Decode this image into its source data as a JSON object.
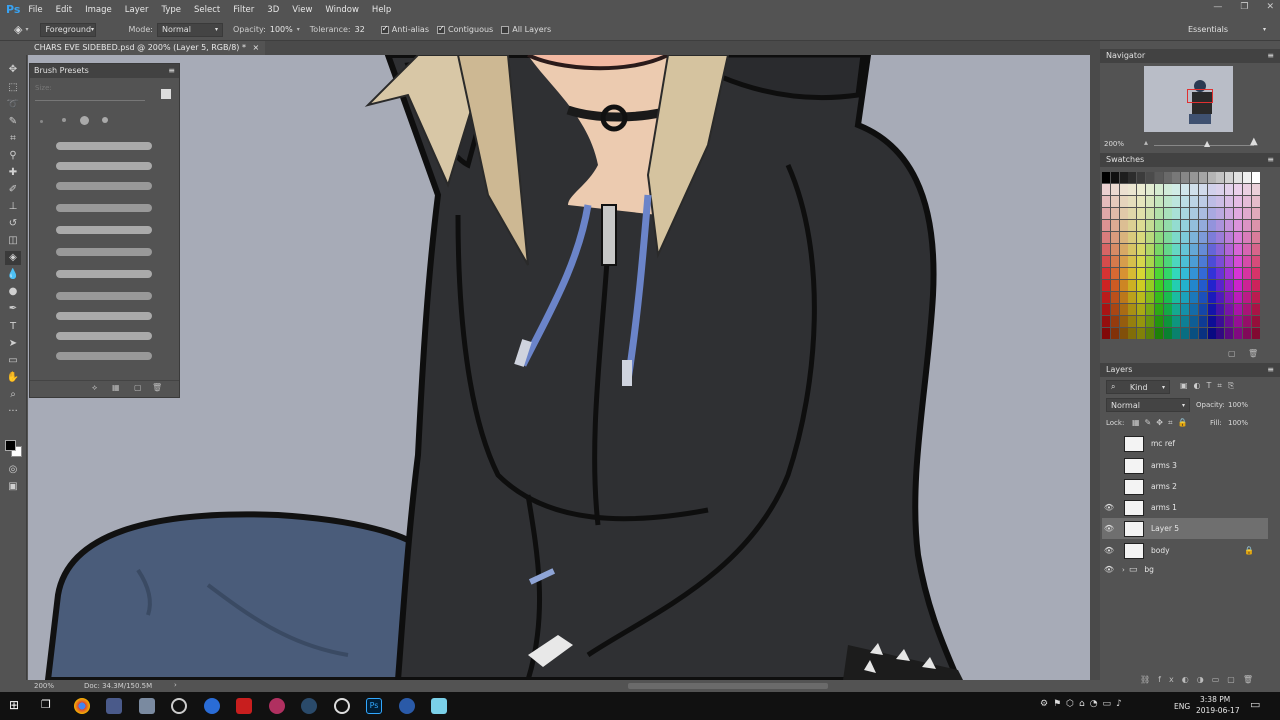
{
  "app": {
    "logo": "Ps"
  },
  "menu": [
    "File",
    "Edit",
    "Image",
    "Layer",
    "Type",
    "Select",
    "Filter",
    "3D",
    "View",
    "Window",
    "Help"
  ],
  "window_controls": [
    "—",
    "❐",
    "✕"
  ],
  "options": {
    "tool_preset": "Foreground",
    "mode_label": "Mode:",
    "mode_value": "Normal",
    "opacity_label": "Opacity:",
    "opacity_value": "100%",
    "tolerance_label": "Tolerance:",
    "tolerance_value": "32",
    "antialias_label": "Anti-alias",
    "contiguous_label": "Contiguous",
    "alllayers_label": "All Layers",
    "workspace": "Essentials"
  },
  "document": {
    "tab_title": "CHARS EVE SIDEBED.psd @ 200% (Layer 5, RGB/8) *",
    "close": "×"
  },
  "status": {
    "zoom": "200%",
    "doc": "Doc: 34.3M/150.5M",
    "arrow": "›"
  },
  "brush_presets": {
    "title": "Brush Presets",
    "size_label": "Size:"
  },
  "navigator": {
    "title": "Navigator",
    "zoom": "200%"
  },
  "swatches": {
    "title": "Swatches"
  },
  "layers_panel": {
    "title": "Layers",
    "filter": "Kind",
    "blend": "Normal",
    "opacity_label": "Opacity:",
    "opacity_value": "100%",
    "lock_label": "Lock:",
    "fill_label": "Fill:",
    "fill_value": "100%",
    "layers": [
      {
        "name": "mc ref",
        "visible": false
      },
      {
        "name": "arms 3",
        "visible": false
      },
      {
        "name": "arms 2",
        "visible": false
      },
      {
        "name": "arms 1",
        "visible": true
      },
      {
        "name": "Layer 5",
        "visible": true,
        "selected": true
      },
      {
        "name": "body",
        "visible": true,
        "locked": true
      },
      {
        "name": "bg",
        "visible": true,
        "group": true
      }
    ]
  },
  "taskbar": {
    "lang": "ENG",
    "time": "3:38 PM",
    "date": "2019-06-17"
  },
  "colors": {
    "accent": "#39a3f2",
    "canvas_bg": "#a7abb7",
    "hoodie": "#2f3033",
    "jeans": "#4a5c7a",
    "drawstring": "#6b84c9"
  }
}
